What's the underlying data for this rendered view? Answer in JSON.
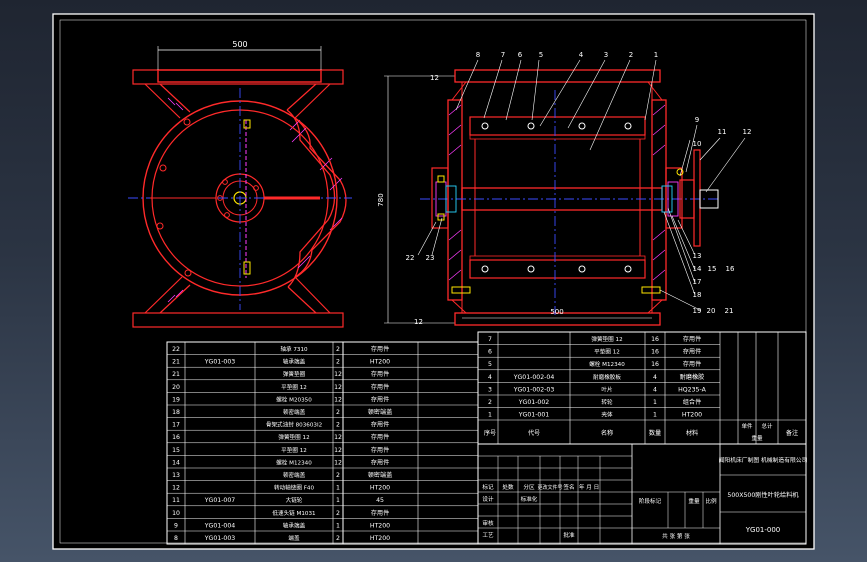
{
  "drawing": {
    "dimensions": {
      "width_left": "500",
      "height_left": "780",
      "flange_top": "12",
      "flange_bottom": "12",
      "length_right": "500"
    },
    "balloons": [
      "1",
      "2",
      "3",
      "4",
      "5",
      "6",
      "7",
      "8",
      "9",
      "10",
      "11",
      "12",
      "13",
      "14",
      "15",
      "16",
      "17",
      "18",
      "19",
      "20",
      "21",
      "22",
      "23"
    ]
  },
  "bom_left": [
    {
      "no": "22",
      "code": "",
      "name": "轴承 7310",
      "qty": "2",
      "mat": "存用件"
    },
    {
      "no": "21",
      "code": "YG01-003",
      "name": "轴承端盖",
      "qty": "2",
      "mat": "HT200"
    },
    {
      "no": "21",
      "code": "",
      "name": "弹簧垫圈",
      "qty": "12",
      "mat": "存用件"
    },
    {
      "no": "20",
      "code": "",
      "name": "平垫圈 12",
      "qty": "12",
      "mat": "存用件"
    },
    {
      "no": "19",
      "code": "",
      "name": "螺栓 M20350",
      "qty": "12",
      "mat": "存用件"
    },
    {
      "no": "18",
      "code": "",
      "name": "顿密端盖",
      "qty": "2",
      "mat": "顿密端盖"
    },
    {
      "no": "17",
      "code": "",
      "name": "骨架式油封 803603I2",
      "qty": "2",
      "mat": "存用件"
    },
    {
      "no": "16",
      "code": "",
      "name": "弹簧垫圈 12",
      "qty": "12",
      "mat": "存用件"
    },
    {
      "no": "15",
      "code": "",
      "name": "平垫圈 12",
      "qty": "12",
      "mat": "存用件"
    },
    {
      "no": "14",
      "code": "",
      "name": "螺栓 M12340",
      "qty": "12",
      "mat": "存用件"
    },
    {
      "no": "13",
      "code": "",
      "name": "顿密端盖",
      "qty": "2",
      "mat": "顿密端盖"
    },
    {
      "no": "12",
      "code": "",
      "name": "转动轴链圈 F40",
      "qty": "1",
      "mat": "HT200"
    },
    {
      "no": "11",
      "code": "YG01-007",
      "name": "大链轮",
      "qty": "1",
      "mat": "45"
    },
    {
      "no": "10",
      "code": "",
      "name": "低速头链 M1031",
      "qty": "2",
      "mat": "存用件"
    },
    {
      "no": "9",
      "code": "YG01-004",
      "name": "轴承端盖",
      "qty": "1",
      "mat": "HT200"
    },
    {
      "no": "8",
      "code": "YG01-003",
      "name": "端盖",
      "qty": "2",
      "mat": "HT200"
    }
  ],
  "bom_right": [
    {
      "no": "7",
      "code": "",
      "name": "弹簧垫圈 12",
      "qty": "16",
      "mat": "存用件"
    },
    {
      "no": "6",
      "code": "",
      "name": "平垫圈 12",
      "qty": "16",
      "mat": "存用件"
    },
    {
      "no": "5",
      "code": "",
      "name": "螺栓 M12340",
      "qty": "16",
      "mat": "存用件"
    },
    {
      "no": "4",
      "code": "YG01-002-04",
      "name": "耐磨橡胶板",
      "qty": "4",
      "mat": "耐磨橡胶"
    },
    {
      "no": "3",
      "code": "YG01-002-03",
      "name": "叶片",
      "qty": "4",
      "mat": "HQ235-A"
    },
    {
      "no": "2",
      "code": "YG01-002",
      "name": "转轮",
      "qty": "1",
      "mat": "组合件"
    },
    {
      "no": "1",
      "code": "YG01-001",
      "name": "壳体",
      "qty": "1",
      "mat": "HT200"
    }
  ],
  "bom_header": {
    "no": "序号",
    "code": "代号",
    "name": "名称",
    "qty": "数量",
    "mat": "材料",
    "unit_wt": "单件",
    "total_wt": "总计",
    "weight": "重量",
    "remark": "备注"
  },
  "title_block": {
    "company": "闻阳机床厂制图 机械制造有限公司",
    "product": "500X500刚性叶轮给料机",
    "drawing_no": "YG01-000",
    "labels": {
      "mark": "标记",
      "count": "处数",
      "zone": "分区",
      "change_doc": "更改文件号",
      "sign": "签名",
      "date": "年 月 日",
      "design": "设计",
      "check": "审核",
      "process": "工艺",
      "approve": "批准",
      "standard": "标准化",
      "stage_mark": "阶段标记",
      "weight": "重量",
      "ratio": "比例",
      "sheets": "共  张  第  张"
    }
  },
  "colors": {
    "frame": "#ffffff",
    "red": "#ff2a2a",
    "blue": "#3c4cff",
    "magenta": "#ff3cff",
    "cyan": "#29d6ff",
    "yellow": "#ffe600",
    "green": "#2aff2a"
  }
}
